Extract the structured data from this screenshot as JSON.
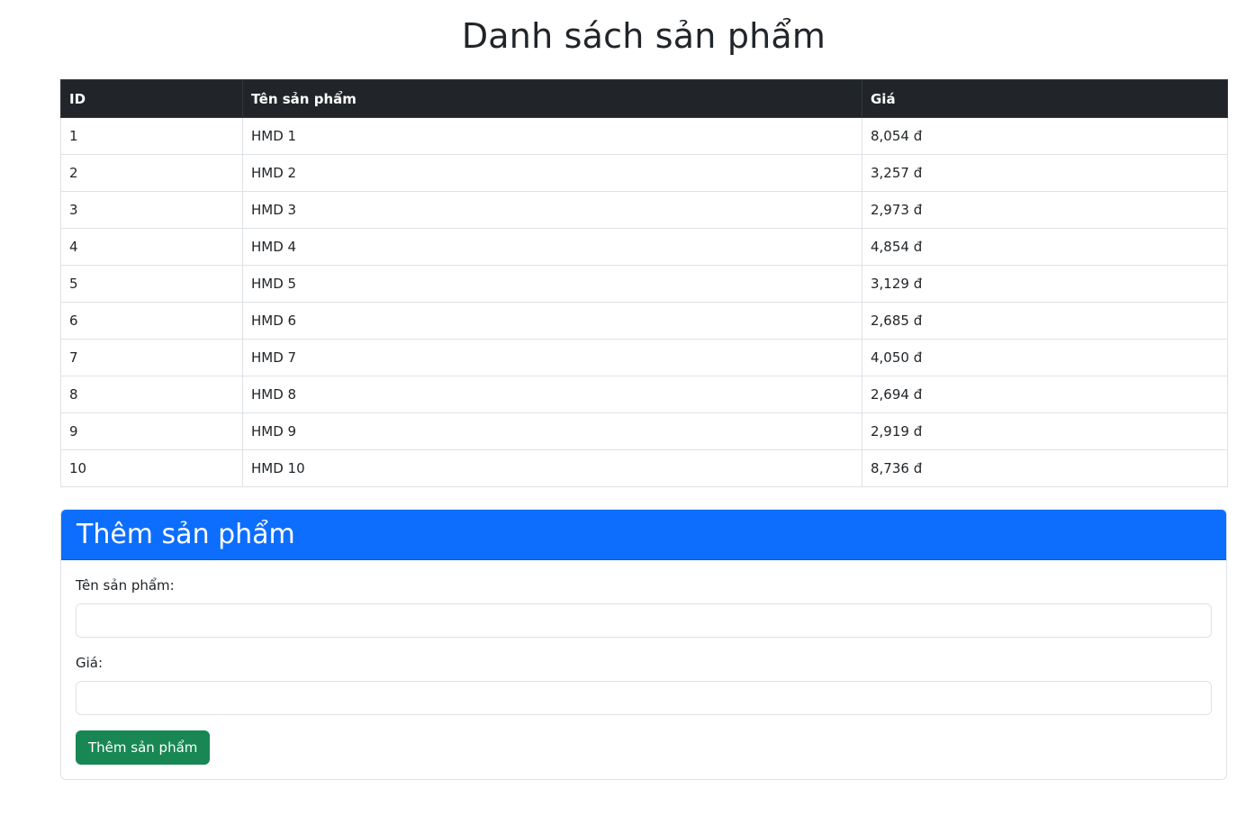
{
  "page": {
    "title": "Danh sách sản phẩm"
  },
  "table": {
    "headers": {
      "id": "ID",
      "name": "Tên sản phẩm",
      "price": "Giá"
    },
    "rows": [
      {
        "id": "1",
        "name": "HMD 1",
        "price": "8,054 đ"
      },
      {
        "id": "2",
        "name": "HMD 2",
        "price": "3,257 đ"
      },
      {
        "id": "3",
        "name": "HMD 3",
        "price": "2,973 đ"
      },
      {
        "id": "4",
        "name": "HMD 4",
        "price": "4,854 đ"
      },
      {
        "id": "5",
        "name": "HMD 5",
        "price": "3,129 đ"
      },
      {
        "id": "6",
        "name": "HMD 6",
        "price": "2,685 đ"
      },
      {
        "id": "7",
        "name": "HMD 7",
        "price": "4,050 đ"
      },
      {
        "id": "8",
        "name": "HMD 8",
        "price": "2,694 đ"
      },
      {
        "id": "9",
        "name": "HMD 9",
        "price": "2,919 đ"
      },
      {
        "id": "10",
        "name": "HMD 10",
        "price": "8,736 đ"
      }
    ]
  },
  "add_form": {
    "header": "Thêm sản phẩm",
    "name_label": "Tên sản phẩm:",
    "name_value": "",
    "price_label": "Giá:",
    "price_value": "",
    "submit_label": "Thêm sản phẩm"
  },
  "colors": {
    "table_header_bg": "#212529",
    "card_header_bg": "#0d6efd",
    "submit_button_bg": "#198754"
  }
}
